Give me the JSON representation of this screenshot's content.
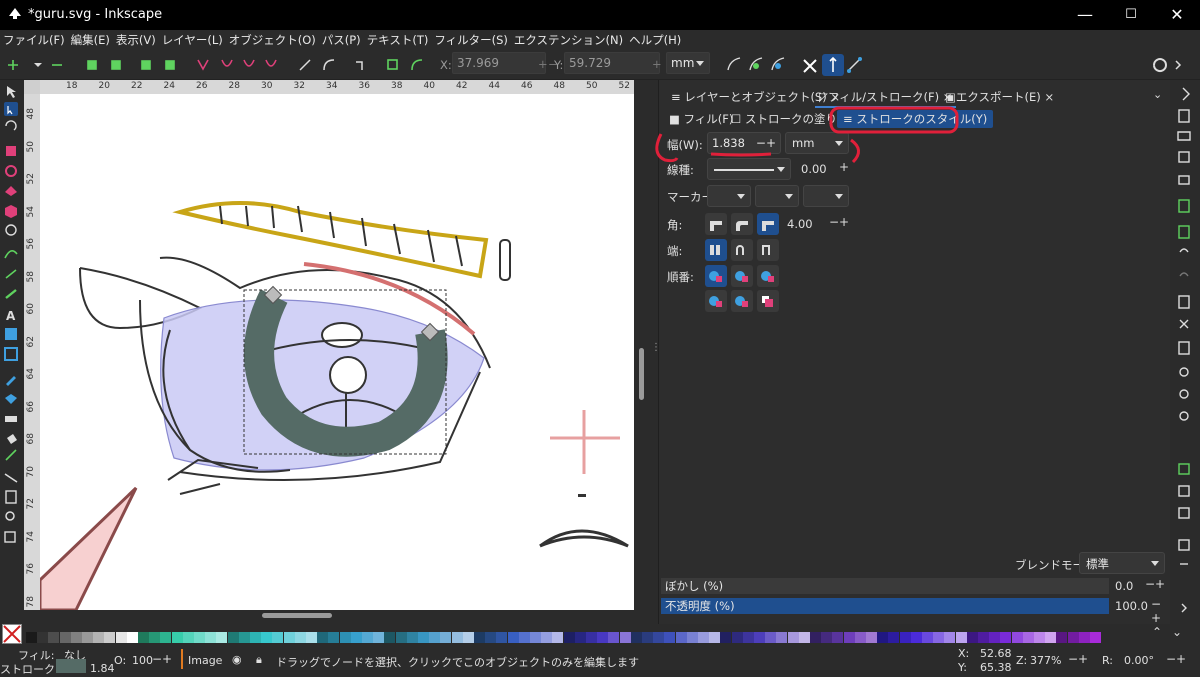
{
  "window": {
    "title": "*guru.svg - Inkscape",
    "minimize": "—",
    "maximize": "☐",
    "close": "✕"
  },
  "menu": [
    "ファイル(F)",
    "編集(E)",
    "表示(V)",
    "レイヤー(L)",
    "オブジェクト(O)",
    "パス(P)",
    "テキスト(T)",
    "フィルター(S)",
    "エクステンション(N)",
    "ヘルプ(H)"
  ],
  "toolbar": {
    "x_label": "X:",
    "x_value": "37.969",
    "y_label": "Y:",
    "y_value": "59.729",
    "unit": "mm",
    "minus": "−",
    "plus": "+"
  },
  "rulers": {
    "horizontal": [
      "18",
      "20",
      "22",
      "24",
      "26",
      "28",
      "30",
      "32",
      "34",
      "36",
      "38",
      "40",
      "42",
      "44",
      "46",
      "48",
      "50",
      "52"
    ],
    "vertical": [
      "48",
      "50",
      "52",
      "54",
      "56",
      "58",
      "60",
      "62",
      "64",
      "66",
      "68",
      "70",
      "72",
      "74",
      "76",
      "78"
    ]
  },
  "panel": {
    "tabs": [
      {
        "label": "レイヤーとオブジェクト(S)",
        "close": "×"
      },
      {
        "label": "フィル/ストローク(F)",
        "close": "×"
      },
      {
        "label": "エクスポート(E)",
        "close": "×"
      }
    ],
    "subtabs": [
      "フィル(F)",
      "ストロークの塗り(P)",
      "ストロークのスタイル(Y)"
    ],
    "width_label": "幅(W):",
    "width_value": "1.838",
    "width_unit": "mm",
    "dash_label": "線種:",
    "dash_offset": "0.00",
    "marker_label": "マーカー:",
    "join_label": "角:",
    "miter_value": "4.00",
    "cap_label": "端:",
    "order_label": "順番:",
    "blend_label": "ブレンドモード:",
    "blend_value": "標準",
    "blur_label": "ぼかし (%)",
    "blur_value": "0.0",
    "opacity_label": "不透明度 (%)",
    "opacity_value": "100.0",
    "opacity_fraction": 1.0
  },
  "status": {
    "fill_label": "フィル:",
    "fill_value": "なし",
    "stroke_label": "ストローク:",
    "stroke_width": "1.84",
    "o_label": "O:",
    "o_value": "100",
    "layer": "Image",
    "message": "ドラッグでノードを選択、クリックでこのオブジェクトのみを編集します",
    "x_label": "X:",
    "x_value": "52.68",
    "y_label": "Y:",
    "y_value": "65.38",
    "z_label": "Z:",
    "zoom": "377%",
    "r_label": "R:",
    "rotation": "0.00°"
  },
  "colors": {
    "accent": "#1f4f8f",
    "annotation_red": "#e0203a",
    "selected_path": "#556b66",
    "iris_fill": "#c9c9f5"
  }
}
